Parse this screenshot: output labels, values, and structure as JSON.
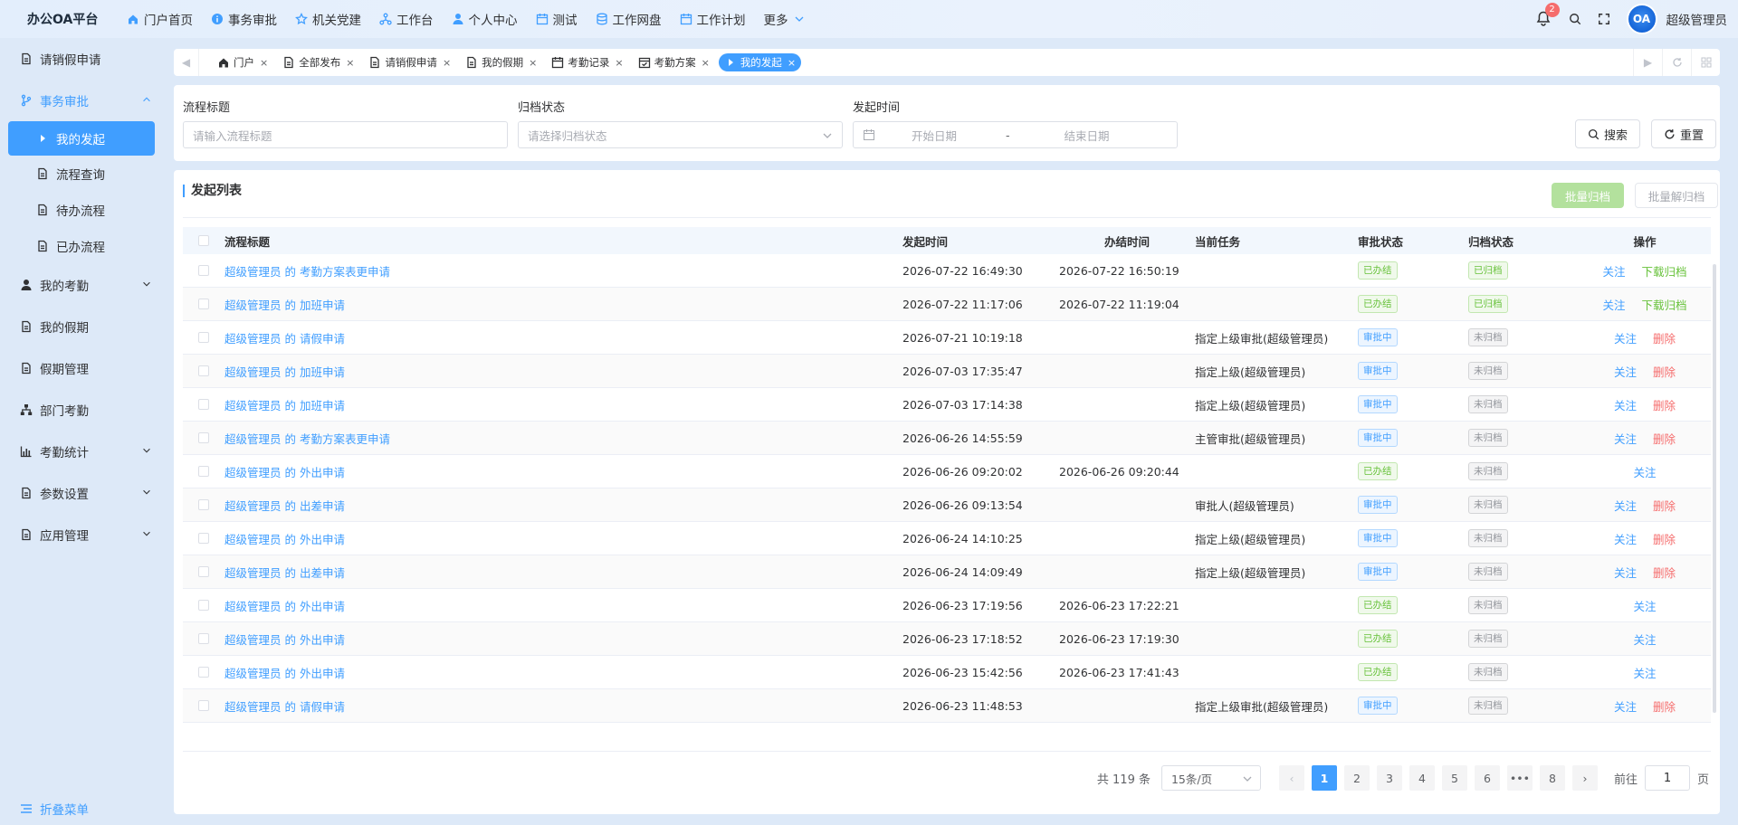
{
  "app": {
    "brand": "办公OA平台",
    "nav": [
      {
        "label": "门户首页",
        "icon": "home-icon"
      },
      {
        "label": "事务审批",
        "icon": "info-circle-icon"
      },
      {
        "label": "机关党建",
        "icon": "star-icon"
      },
      {
        "label": "工作台",
        "icon": "workbench-icon"
      },
      {
        "label": "个人中心",
        "icon": "user-icon"
      },
      {
        "label": "测试",
        "icon": "calendar-icon"
      },
      {
        "label": "工作网盘",
        "icon": "database-icon"
      },
      {
        "label": "工作计划",
        "icon": "calendar-icon"
      },
      {
        "label": "更多",
        "icon": "chevron-down-icon"
      }
    ],
    "notification_count": "2",
    "avatar_text": "OA",
    "username": "超级管理员"
  },
  "sidebar": {
    "items": [
      {
        "label": "请销假申请",
        "icon": "document-icon"
      },
      {
        "label": "事务审批",
        "icon": "branch-icon",
        "expanded": true
      },
      {
        "label": "我的考勤",
        "icon": "user-icon",
        "expandable": true
      },
      {
        "label": "我的假期",
        "icon": "document-icon"
      },
      {
        "label": "假期管理",
        "icon": "document-icon"
      },
      {
        "label": "部门考勤",
        "icon": "org-chart-icon"
      },
      {
        "label": "考勤统计",
        "icon": "bar-chart-icon",
        "expandable": true
      },
      {
        "label": "参数设置",
        "icon": "document-icon",
        "expandable": true
      },
      {
        "label": "应用管理",
        "icon": "document-icon",
        "expandable": true
      }
    ],
    "sub_items": [
      {
        "label": "我的发起",
        "active": true
      },
      {
        "label": "流程查询"
      },
      {
        "label": "待办流程"
      },
      {
        "label": "已办流程"
      }
    ],
    "collapse_label": "折叠菜单"
  },
  "tabs": [
    {
      "label": "门户",
      "icon": "home-icon"
    },
    {
      "label": "全部发布",
      "icon": "document-icon"
    },
    {
      "label": "请销假申请",
      "icon": "document-icon"
    },
    {
      "label": "我的假期",
      "icon": "document-icon"
    },
    {
      "label": "考勤记录",
      "icon": "calendar-icon"
    },
    {
      "label": "考勤方案",
      "icon": "check-calendar-icon"
    },
    {
      "label": "我的发起",
      "icon": "caret-right-icon",
      "active": true
    }
  ],
  "search": {
    "title_label": "流程标题",
    "title_placeholder": "请输入流程标题",
    "archive_label": "归档状态",
    "archive_placeholder": "请选择归档状态",
    "time_label": "发起时间",
    "start_placeholder": "开始日期",
    "range_separator": "-",
    "end_placeholder": "结束日期",
    "search_button": "搜索",
    "reset_button": "重置"
  },
  "list": {
    "title": "发起列表",
    "batch_archive": "批量归档",
    "batch_unarchive": "批量解归档",
    "columns": [
      "流程标题",
      "发起时间",
      "办结时间",
      "当前任务",
      "审批状态",
      "归档状态",
      "操作"
    ],
    "rows": [
      {
        "title": "超级管理员 的 考勤方案表更申请",
        "start": "2026-07-22 16:49:30",
        "end": "2026-07-22 16:50:19",
        "task": "",
        "approval": "已办结",
        "archive": "已归档",
        "ops": [
          "关注",
          "下载归档"
        ]
      },
      {
        "title": "超级管理员 的 加班申请",
        "start": "2026-07-22 11:17:06",
        "end": "2026-07-22 11:19:04",
        "task": "",
        "approval": "已办结",
        "archive": "已归档",
        "ops": [
          "关注",
          "下载归档"
        ]
      },
      {
        "title": "超级管理员 的 请假申请",
        "start": "2026-07-21 10:19:18",
        "end": "",
        "task": "指定上级审批(超级管理员)",
        "approval": "审批中",
        "archive": "未归档",
        "ops": [
          "关注",
          "删除"
        ]
      },
      {
        "title": "超级管理员 的 加班申请",
        "start": "2026-07-03 17:35:47",
        "end": "",
        "task": "指定上级(超级管理员)",
        "approval": "审批中",
        "archive": "未归档",
        "ops": [
          "关注",
          "删除"
        ]
      },
      {
        "title": "超级管理员 的 加班申请",
        "start": "2026-07-03 17:14:38",
        "end": "",
        "task": "指定上级(超级管理员)",
        "approval": "审批中",
        "archive": "未归档",
        "ops": [
          "关注",
          "删除"
        ]
      },
      {
        "title": "超级管理员 的 考勤方案表更申请",
        "start": "2026-06-26 14:55:59",
        "end": "",
        "task": "主管审批(超级管理员)",
        "approval": "审批中",
        "archive": "未归档",
        "ops": [
          "关注",
          "删除"
        ]
      },
      {
        "title": "超级管理员 的 外出申请",
        "start": "2026-06-26 09:20:02",
        "end": "2026-06-26 09:20:44",
        "task": "",
        "approval": "已办结",
        "archive": "未归档",
        "ops": [
          "关注"
        ]
      },
      {
        "title": "超级管理员 的 出差申请",
        "start": "2026-06-26 09:13:54",
        "end": "",
        "task": "审批人(超级管理员)",
        "approval": "审批中",
        "archive": "未归档",
        "ops": [
          "关注",
          "删除"
        ]
      },
      {
        "title": "超级管理员 的 外出申请",
        "start": "2026-06-24 14:10:25",
        "end": "",
        "task": "指定上级(超级管理员)",
        "approval": "审批中",
        "archive": "未归档",
        "ops": [
          "关注",
          "删除"
        ]
      },
      {
        "title": "超级管理员 的 出差申请",
        "start": "2026-06-24 14:09:49",
        "end": "",
        "task": "指定上级(超级管理员)",
        "approval": "审批中",
        "archive": "未归档",
        "ops": [
          "关注",
          "删除"
        ]
      },
      {
        "title": "超级管理员 的 外出申请",
        "start": "2026-06-23 17:19:56",
        "end": "2026-06-23 17:22:21",
        "task": "",
        "approval": "已办结",
        "archive": "未归档",
        "ops": [
          "关注"
        ]
      },
      {
        "title": "超级管理员 的 外出申请",
        "start": "2026-06-23 17:18:52",
        "end": "2026-06-23 17:19:30",
        "task": "",
        "approval": "已办结",
        "archive": "未归档",
        "ops": [
          "关注"
        ]
      },
      {
        "title": "超级管理员 的 外出申请",
        "start": "2026-06-23 15:42:56",
        "end": "2026-06-23 17:41:43",
        "task": "",
        "approval": "已办结",
        "archive": "未归档",
        "ops": [
          "关注"
        ]
      },
      {
        "title": "超级管理员 的 请假申请",
        "start": "2026-06-23 11:48:53",
        "end": "",
        "task": "指定上级审批(超级管理员)",
        "approval": "审批中",
        "archive": "未归档",
        "ops": [
          "关注",
          "删除"
        ]
      }
    ]
  },
  "pagination": {
    "total_text": "共 119 条",
    "page_size": "15条/页",
    "pages": [
      "1",
      "2",
      "3",
      "4",
      "5",
      "6",
      "•••",
      "8"
    ],
    "current": "1",
    "goto_label": "前往",
    "goto_value": "1",
    "page_suffix": "页"
  },
  "colors": {
    "primary": "#409eff",
    "success": "#67c23a",
    "danger": "#f56c6c",
    "background": "#dde9f8"
  }
}
